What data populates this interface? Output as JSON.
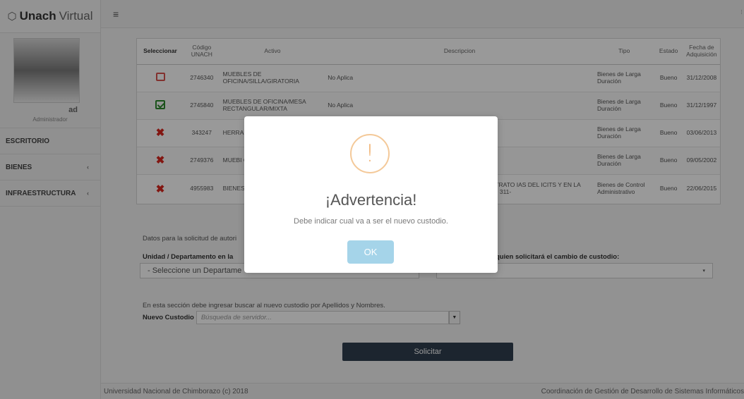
{
  "brand": {
    "part_a": "Unach",
    "part_b": "Virtual"
  },
  "user": {
    "name_fragment": "ad",
    "role": "Administrador"
  },
  "nav": [
    {
      "label": "ESCRITORIO",
      "chevron": ""
    },
    {
      "label": "BIENES",
      "chevron": "‹"
    },
    {
      "label": "INFRAESTRUCTURA",
      "chevron": "‹"
    }
  ],
  "topbar": {
    "menu_icon": "≡",
    "right_glyph": "⁝"
  },
  "table": {
    "headers": {
      "seleccionar": "Seleccionar",
      "codigo": "Código UNACH",
      "activo": "Activo",
      "descripcion": "Descripcion",
      "tipo": "Tipo",
      "estado": "Estado",
      "fecha": "Fecha de Adquisición"
    },
    "rows": [
      {
        "state": "unchecked",
        "codigo": "2746340",
        "activo": "MUEBLES DE OFICINA/SILLA/GIRATORIA",
        "descripcion": "No Aplica",
        "tipo": "Bienes de Larga Duración",
        "estado": "Bueno",
        "fecha": "31/12/2008"
      },
      {
        "state": "checked",
        "codigo": "2745840",
        "activo": "MUEBLES DE OFICINA/MESA RECTANGULAR/MIXTA",
        "descripcion": "No Aplica",
        "tipo": "Bienes de Larga Duración",
        "estado": "Bueno",
        "fecha": "31/12/1997"
      },
      {
        "state": "blocked",
        "codigo": "343247",
        "activo": "HERRA ESPEC MANU",
        "descripcion": "",
        "tipo": "Bienes de Larga Duración",
        "estado": "Bueno",
        "fecha": "03/06/2013"
      },
      {
        "state": "blocked",
        "codigo": "2749376",
        "activo": "MUEBI OFICIN",
        "descripcion": "",
        "tipo": "Bienes de Larga Duración",
        "estado": "Bueno",
        "fecha": "09/05/2002"
      },
      {
        "state": "blocked",
        "codigo": "4955983",
        "activo": "BIENES CONTR VOLTA",
        "descripcion": "ARIOS EQUIPOS, CONTRATO IAS DEL ICITS Y EN LA /ENDA ├æO ,PROCESO 311-",
        "tipo": "Bienes de Control Administrativo",
        "estado": "Bueno",
        "fecha": "22/06/2015"
      }
    ]
  },
  "form": {
    "intro": "Datos para la solicitud de autori",
    "unit_label": "Unidad / Departamento en la",
    "unit_select": "- Seleccione un Departame",
    "dep_label": "quien solicitará el cambio de custodio:",
    "dep_caret": "▾",
    "section_text": "En esta sección debe ingresar buscar al nuevo custodio por Apellidos y Nombres.",
    "custodio_label": "Nuevo Custodio",
    "custodio_placeholder": "Búsqueda de servidor...",
    "custodio_caret": "▼",
    "submit": "Solicitar"
  },
  "footer": {
    "left": "Universidad Nacional de Chimborazo (c) 2018",
    "right": "Coordinación de Gestión de Desarrollo de Sistemas Informáticos"
  },
  "modal": {
    "icon_glyph": "!",
    "title": "¡Advertencia!",
    "text": "Debe indicar cual va a ser el nuevo custodio.",
    "ok": "OK"
  },
  "colors": {
    "warning": "#f8bb86",
    "ok_button": "#a5d4e9",
    "solicitar_button": "#2f3e4f",
    "check_green": "#2e8b2e",
    "x_red": "#d9251d"
  }
}
